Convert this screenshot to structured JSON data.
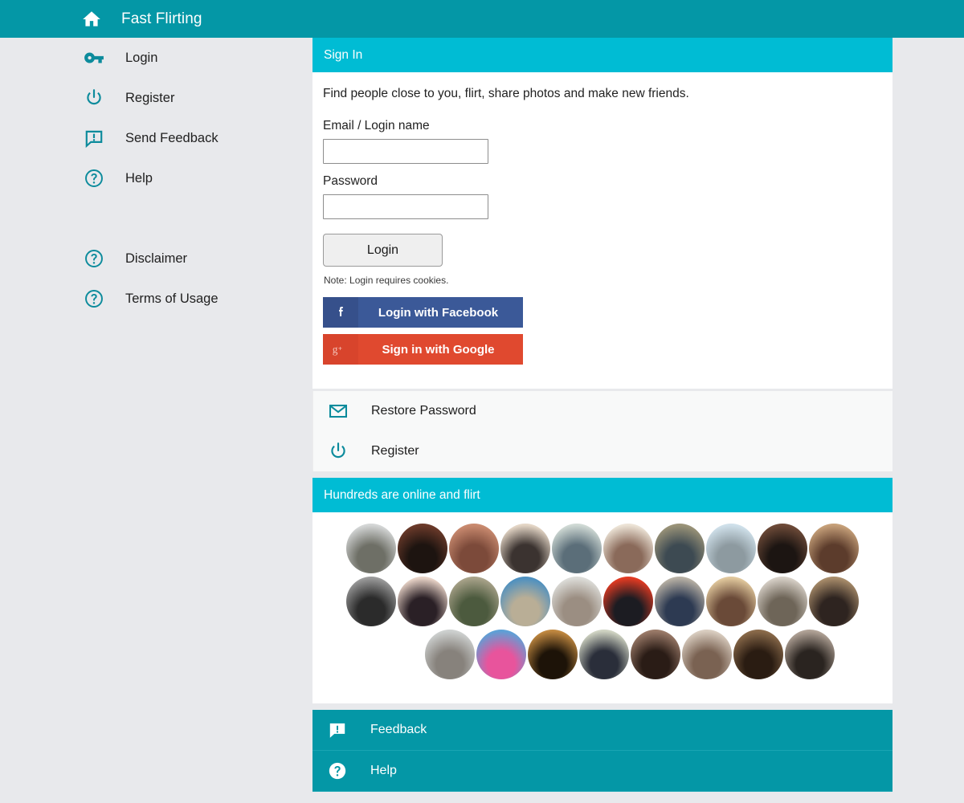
{
  "topbar": {
    "home_icon": "home-icon",
    "brand": "Fast Flirting",
    "bg": "#0497a6"
  },
  "sidebar": {
    "items": [
      {
        "label": "Login",
        "icon": "key-icon"
      },
      {
        "label": "Register",
        "icon": "power-icon"
      },
      {
        "label": "Send Feedback",
        "icon": "feedback-bubble-icon"
      },
      {
        "label": "Help",
        "icon": "question-circle-icon"
      }
    ],
    "secondary_items": [
      {
        "label": "Disclaimer",
        "icon": "question-circle-icon"
      },
      {
        "label": "Terms of Usage",
        "icon": "question-circle-icon"
      }
    ]
  },
  "signin": {
    "header": "Sign In",
    "header_bg": "#00bcd4",
    "intro": "Find people close to you, flirt, share photos and make new friends.",
    "email_label": "Email / Login name",
    "email_value": "",
    "email_placeholder": "",
    "password_label": "Password",
    "password_value": "",
    "password_placeholder": "",
    "login_button": "Login",
    "note": "Note: Login requires cookies.",
    "facebook_button": "Login with Facebook",
    "facebook_color": "#3b5998",
    "google_button": "Sign in with Google",
    "google_color": "#e0492f"
  },
  "links": [
    {
      "label": "Restore Password",
      "icon": "envelope-icon"
    },
    {
      "label": "Register",
      "icon": "power-icon"
    }
  ],
  "online": {
    "header": "Hundreds are online and flirt",
    "header_bg": "#00bcd4",
    "rows": [
      [
        {
          "name": "avatar-1",
          "c1": "#d4d6d6",
          "c2": "#6e6f66"
        },
        {
          "name": "avatar-2",
          "c1": "#6b3a2a",
          "c2": "#1d1410"
        },
        {
          "name": "avatar-3",
          "c1": "#c98a6f",
          "c2": "#7c4a3a"
        },
        {
          "name": "avatar-4",
          "c1": "#e4d6c6",
          "c2": "#3b3330"
        },
        {
          "name": "avatar-5",
          "c1": "#cfd9d4",
          "c2": "#5b6e79"
        },
        {
          "name": "avatar-6",
          "c1": "#ece3d6",
          "c2": "#8a6a5a"
        },
        {
          "name": "avatar-7",
          "c1": "#9a9378",
          "c2": "#3d4a52"
        },
        {
          "name": "avatar-8",
          "c1": "#cfe0ea",
          "c2": "#8d9aa0"
        },
        {
          "name": "avatar-9",
          "c1": "#6d4a38",
          "c2": "#1c1512"
        },
        {
          "name": "avatar-10",
          "c1": "#c6a079",
          "c2": "#5c3c2c"
        }
      ],
      [
        {
          "name": "avatar-11",
          "c1": "#9a9a9a",
          "c2": "#2b2b2b"
        },
        {
          "name": "avatar-12",
          "c1": "#e7d2c6",
          "c2": "#2a2026"
        },
        {
          "name": "avatar-13",
          "c1": "#a8a289",
          "c2": "#4c5a3e"
        },
        {
          "name": "avatar-14",
          "c1": "#4d90c0",
          "c2": "#b9ae96"
        },
        {
          "name": "avatar-15",
          "c1": "#dcdcd8",
          "c2": "#9b8e82"
        },
        {
          "name": "avatar-16",
          "c1": "#e23a22",
          "c2": "#1c1c22"
        },
        {
          "name": "avatar-17",
          "c1": "#b7b0a4",
          "c2": "#2d3a52"
        },
        {
          "name": "avatar-18",
          "c1": "#e0c79c",
          "c2": "#6a4a38"
        },
        {
          "name": "avatar-19",
          "c1": "#d6cfc6",
          "c2": "#6e6558"
        },
        {
          "name": "avatar-20",
          "c1": "#a88c6a",
          "c2": "#2e2420"
        }
      ],
      [
        {
          "name": "avatar-21",
          "c1": "#cdd0cf",
          "c2": "#87827c"
        },
        {
          "name": "avatar-22",
          "c1": "#5da0d6",
          "c2": "#e8549c"
        },
        {
          "name": "avatar-23",
          "c1": "#c08840",
          "c2": "#1d1308"
        },
        {
          "name": "avatar-24",
          "c1": "#cfd3c2",
          "c2": "#2a2e3a"
        },
        {
          "name": "avatar-25",
          "c1": "#9a7a68",
          "c2": "#2a1c16"
        },
        {
          "name": "avatar-26",
          "c1": "#d9cdc0",
          "c2": "#7a6252"
        },
        {
          "name": "avatar-27",
          "c1": "#8a6a4a",
          "c2": "#2a1c12"
        },
        {
          "name": "avatar-28",
          "c1": "#b0a296",
          "c2": "#2a2420"
        }
      ]
    ]
  },
  "footer": [
    {
      "label": "Feedback",
      "icon": "feedback-bubble-filled-icon"
    },
    {
      "label": "Help",
      "icon": "question-circle-filled-icon"
    }
  ]
}
